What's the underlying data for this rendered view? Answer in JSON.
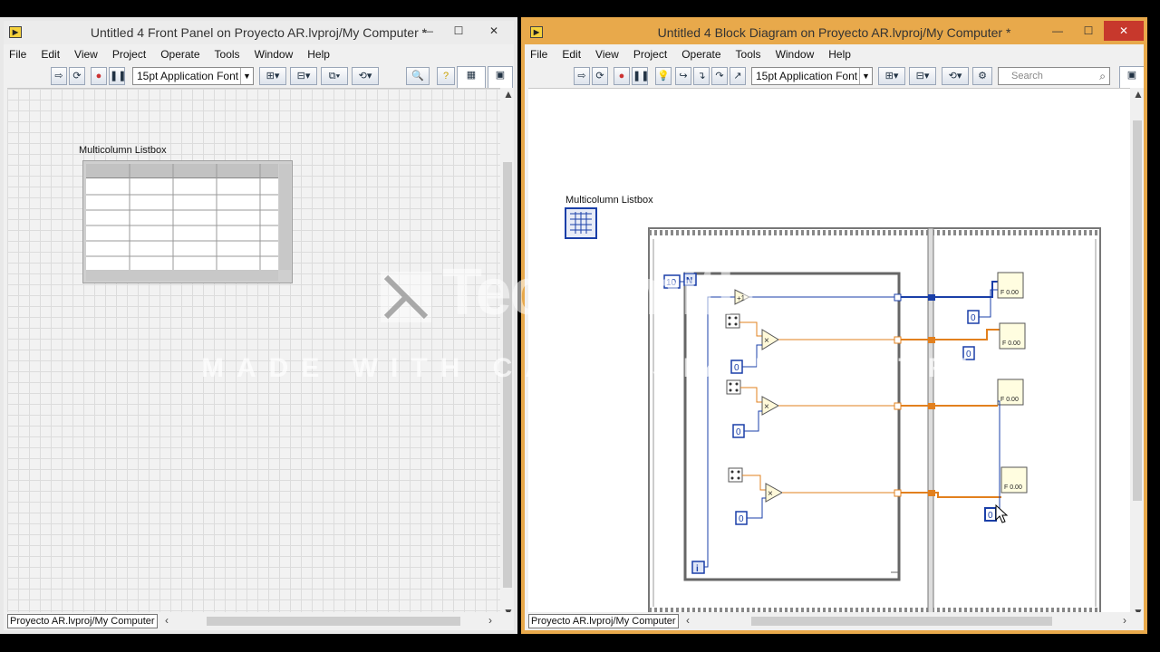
{
  "front_panel": {
    "title": "Untitled 4 Front Panel on Proyecto AR.lvproj/My Computer *",
    "menu": [
      "File",
      "Edit",
      "View",
      "Project",
      "Operate",
      "Tools",
      "Window",
      "Help"
    ],
    "font_select": "15pt Application Font",
    "listbox_label": "Multicolumn Listbox",
    "status_path": "Proyecto AR.lvproj/My Computer"
  },
  "block_diagram": {
    "title": "Untitled 4 Block Diagram on Proyecto AR.lvproj/My Computer *",
    "menu": [
      "File",
      "Edit",
      "View",
      "Project",
      "Operate",
      "Tools",
      "Window",
      "Help"
    ],
    "font_select": "15pt Application Font",
    "search_placeholder": "Search",
    "listbox_terminal_label": "Multicolumn Listbox",
    "loop_count": "10",
    "loop_count_terminal": "N",
    "iteration_terminal": "i",
    "constant_zero": "0",
    "multiply_symbol": "×",
    "status_path": "Proyecto AR.lvproj/My Computer"
  },
  "watermark": {
    "brand": "TechSmith",
    "registered": "®",
    "subtitle": "MADE WITH CAMTASIA FREE TRIAL"
  },
  "colors": {
    "block_diagram_frame": "#e8a94b",
    "blue_wire": "#1a3fa8",
    "orange_wire": "#e2801e",
    "close_button": "#c7382c"
  },
  "icons": [
    "labview-app-icon",
    "run-arrow-icon",
    "run-continuous-icon",
    "abort-icon",
    "pause-icon",
    "search-icon",
    "help-icon",
    "highlight-bulb-icon",
    "dice-random-icon",
    "multiply-icon",
    "increment-icon",
    "format-into-string-icon"
  ]
}
